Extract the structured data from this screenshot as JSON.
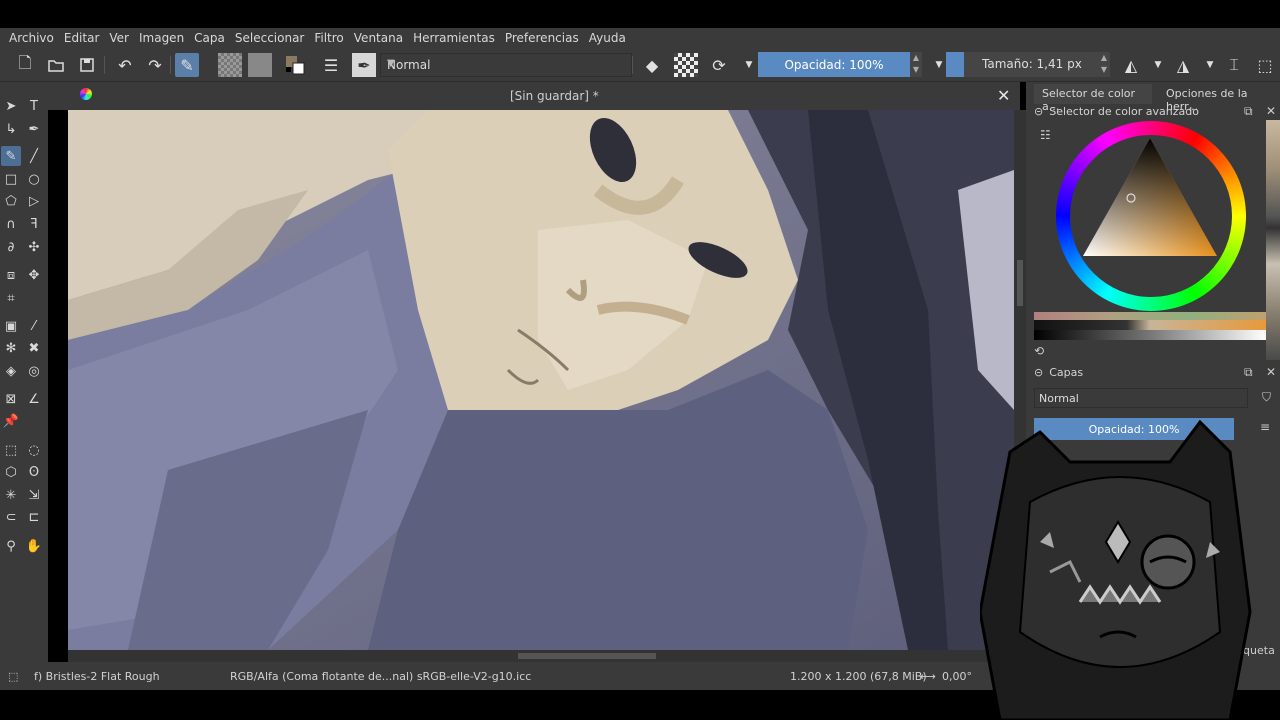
{
  "menu": [
    "Archivo",
    "Editar",
    "Ver",
    "Imagen",
    "Capa",
    "Seleccionar",
    "Filtro",
    "Ventana",
    "Herramientas",
    "Preferencias",
    "Ayuda"
  ],
  "toolbar": {
    "blend_mode": "Normal",
    "opacity_label": "Opacidad: 100%",
    "size_label": "Tamaño: 1,41 px"
  },
  "document": {
    "title": "[Sin guardar]  *"
  },
  "right_dock": {
    "tab1": "Selector de color a...",
    "tab2": "Opciones de la herr...",
    "color_panel_title": "Selector de color avanzado",
    "layers_title": "Capas",
    "layers_blend": "Normal",
    "layers_opacity": "Opacidad:  100%",
    "partial_label": "iqueta"
  },
  "status": {
    "brush": "f) Bristles-2 Flat Rough",
    "color_model": "RGB/Alfa (Coma flotante de...nal)  sRGB-elle-V2-g10.icc",
    "dimensions": "1.200 x 1.200 (67,8 MiB)",
    "rotation": "0,00°"
  },
  "colors": {
    "accent": "#5a8ac2",
    "chrome": "#3a3a3a"
  }
}
